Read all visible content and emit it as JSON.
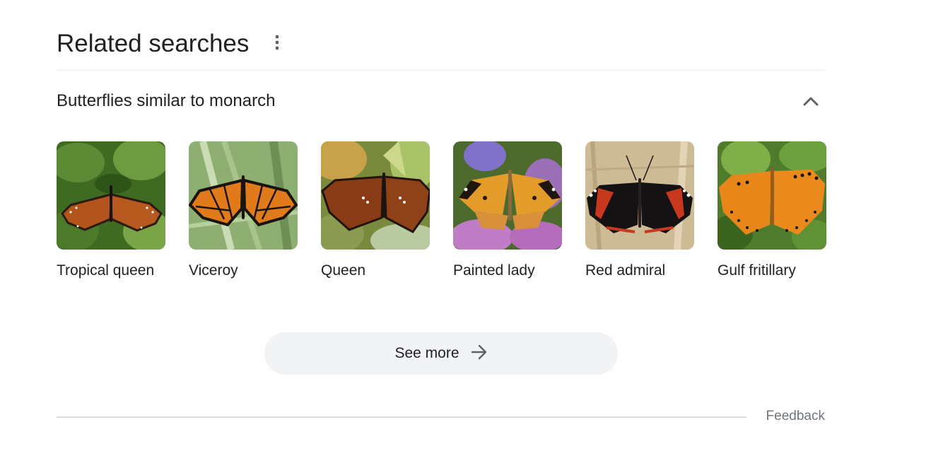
{
  "section": {
    "title": "Related searches",
    "more_icon": "three-dot-vertical-icon"
  },
  "group": {
    "title": "Butterflies similar to monarch",
    "toggle_icon": "chevron-up-icon",
    "expanded": true
  },
  "cards": [
    {
      "label": "Tropical queen",
      "image": "tropical-queen-butterfly-photo"
    },
    {
      "label": "Viceroy",
      "image": "viceroy-butterfly-photo"
    },
    {
      "label": "Queen",
      "image": "queen-butterfly-photo"
    },
    {
      "label": "Painted lady",
      "image": "painted-lady-butterfly-photo"
    },
    {
      "label": "Red admiral",
      "image": "red-admiral-butterfly-photo"
    },
    {
      "label": "Gulf fritillary",
      "image": "gulf-fritillary-butterfly-photo"
    }
  ],
  "see_more": {
    "label": "See more",
    "icon": "arrow-right-icon"
  },
  "feedback": {
    "label": "Feedback"
  },
  "colors": {
    "text": "#202124",
    "muted": "#70757a",
    "button_bg": "#f1f3f4",
    "divider": "#e8eaed"
  }
}
